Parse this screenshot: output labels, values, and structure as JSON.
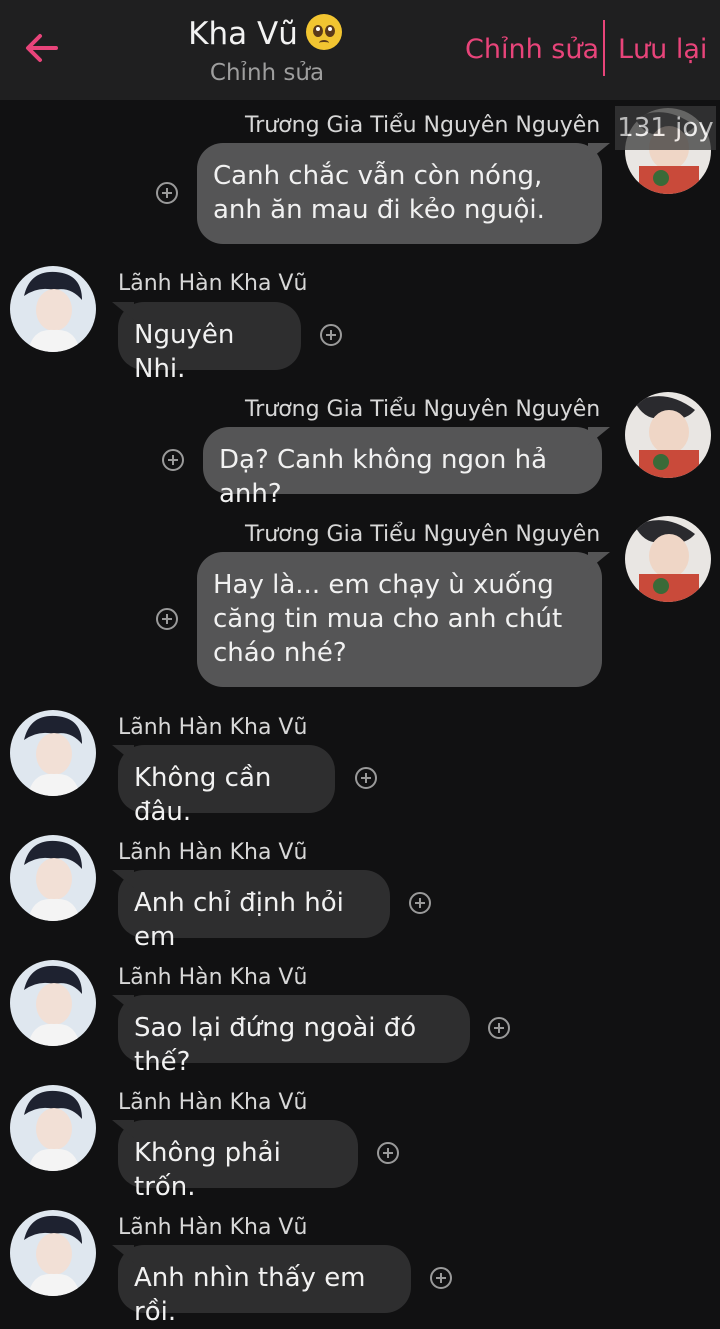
{
  "header": {
    "title": "Kha Vũ",
    "title_emoji": "pleading-face-icon",
    "subtitle": "Chỉnh sửa",
    "edit_label": "Chỉnh sửa",
    "save_label": "Lưu lại",
    "accent_color": "#e8447a"
  },
  "counter_text": "131 joy",
  "messages": [
    {
      "side": "right",
      "sender": "Trương Gia Tiểu Nguyên Nguyên",
      "text": "Canh chắc vẫn còn nóng, anh ăn mau đi kẻo nguội."
    },
    {
      "side": "left",
      "sender": "Lãnh Hàn Kha Vũ",
      "text": "Nguyên Nhi."
    },
    {
      "side": "right",
      "sender": "Trương Gia Tiểu Nguyên Nguyên",
      "text": "Dạ? Canh không ngon hả anh?"
    },
    {
      "side": "right",
      "sender": "Trương Gia Tiểu Nguyên Nguyên",
      "text": "Hay là... em chạy ù xuống căng tin mua cho anh chút cháo nhé?"
    },
    {
      "side": "left",
      "sender": "Lãnh Hàn Kha Vũ",
      "text": "Không cần đâu."
    },
    {
      "side": "left",
      "sender": "Lãnh Hàn Kha Vũ",
      "text": "Anh chỉ định hỏi em"
    },
    {
      "side": "left",
      "sender": "Lãnh Hàn Kha Vũ",
      "text": "Sao lại đứng ngoài đó thế?"
    },
    {
      "side": "left",
      "sender": "Lãnh Hàn Kha Vũ",
      "text": "Không phải trốn."
    },
    {
      "side": "left",
      "sender": "Lãnh Hàn Kha Vũ",
      "text": "Anh nhìn thấy em rồi."
    }
  ]
}
